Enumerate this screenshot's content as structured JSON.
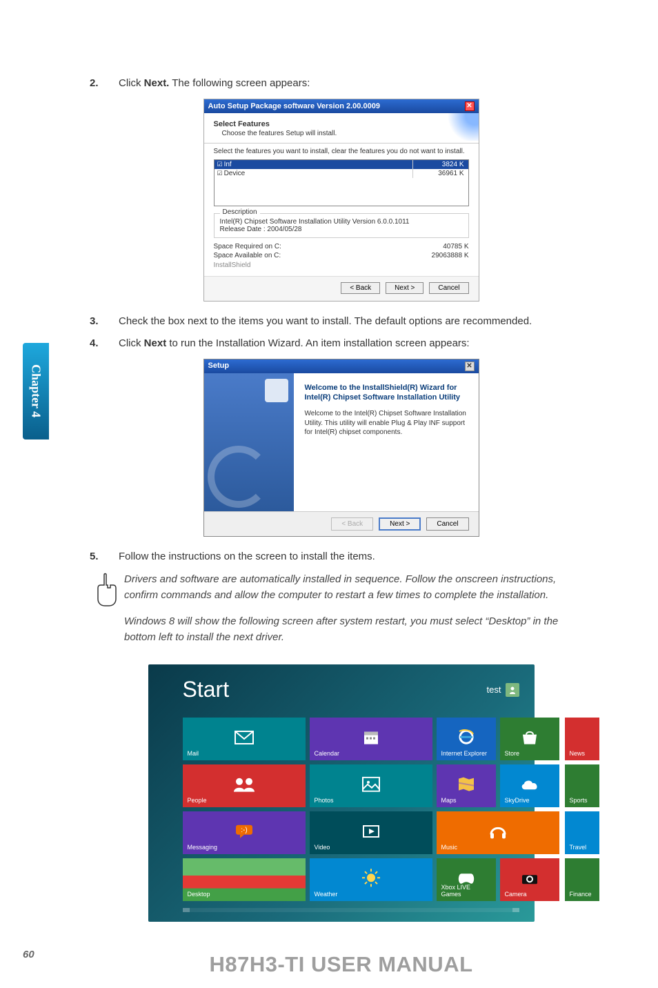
{
  "sideTab": "Chapter 4",
  "pageNumber": "60",
  "footerTitle": "H87H3-TI USER MANUAL",
  "steps": {
    "s2": {
      "num": "2.",
      "pre": "Click ",
      "bold": "Next.",
      "post": " The following screen appears:"
    },
    "s3": {
      "num": "3.",
      "txt": "Check the box next to the items you want to install. The default options are recommended."
    },
    "s4": {
      "num": "4.",
      "pre": "Click ",
      "bold": "Next",
      "post": " to run the Installation Wizard. An item installation screen appears:"
    },
    "s5": {
      "num": "5.",
      "txt": "Follow the instructions on the screen to install the items."
    }
  },
  "dlg1": {
    "title": "Auto Setup Package software Version 2.00.0009",
    "header": "Select Features",
    "subheader": "Choose the features Setup will install.",
    "instruction": "Select the features you want to install, clear the features you do not want to install.",
    "rows": [
      {
        "name": "Inf",
        "size": "3824 K"
      },
      {
        "name": "Device",
        "size": "36961 K"
      }
    ],
    "descLegend": "Description",
    "descLine1": "Intel(R) Chipset Software Installation Utility Version 6.0.0.1011",
    "descLine2": "Release Date : 2004/05/28",
    "spaceReqL": "Space Required on  C:",
    "spaceReqV": "40785 K",
    "spaceAvL": "Space Available on  C:",
    "spaceAvV": "29063888 K",
    "shield": "InstallShield",
    "back": "< Back",
    "next": "Next >",
    "cancel": "Cancel"
  },
  "dlg2": {
    "title": "Setup",
    "h1": "Welcome to the InstallShield(R) Wizard for Intel(R) Chipset Software Installation Utility",
    "p": "Welcome to the Intel(R) Chipset Software Installation Utility.  This utility will enable Plug & Play INF support for Intel(R) chipset components.",
    "back": "< Back",
    "next": "Next >",
    "cancel": "Cancel"
  },
  "note": {
    "p1": "Drivers and software are automatically installed in sequence. Follow the onscreen instructions, confirm commands and allow the computer to restart a few times to complete the installation.",
    "p2": "Windows 8 will show the following screen after system restart, you must select “Desktop” in the bottom left to install the next driver."
  },
  "w8": {
    "start": "Start",
    "user": "test",
    "tiles": {
      "mail": "Mail",
      "calendar": "Calendar",
      "ie": "Internet Explorer",
      "store": "Store",
      "news": "News",
      "people": "People",
      "photos": "Photos",
      "maps": "Maps",
      "skydrive": "SkyDrive",
      "sports": "Sports",
      "messaging": "Messaging",
      "video": "Video",
      "music": "Music",
      "travel": "Travel",
      "desktop": "Desktop",
      "weather": "Weather",
      "xbox": "Xbox LIVE Games",
      "camera": "Camera",
      "finance": "Finance"
    }
  }
}
